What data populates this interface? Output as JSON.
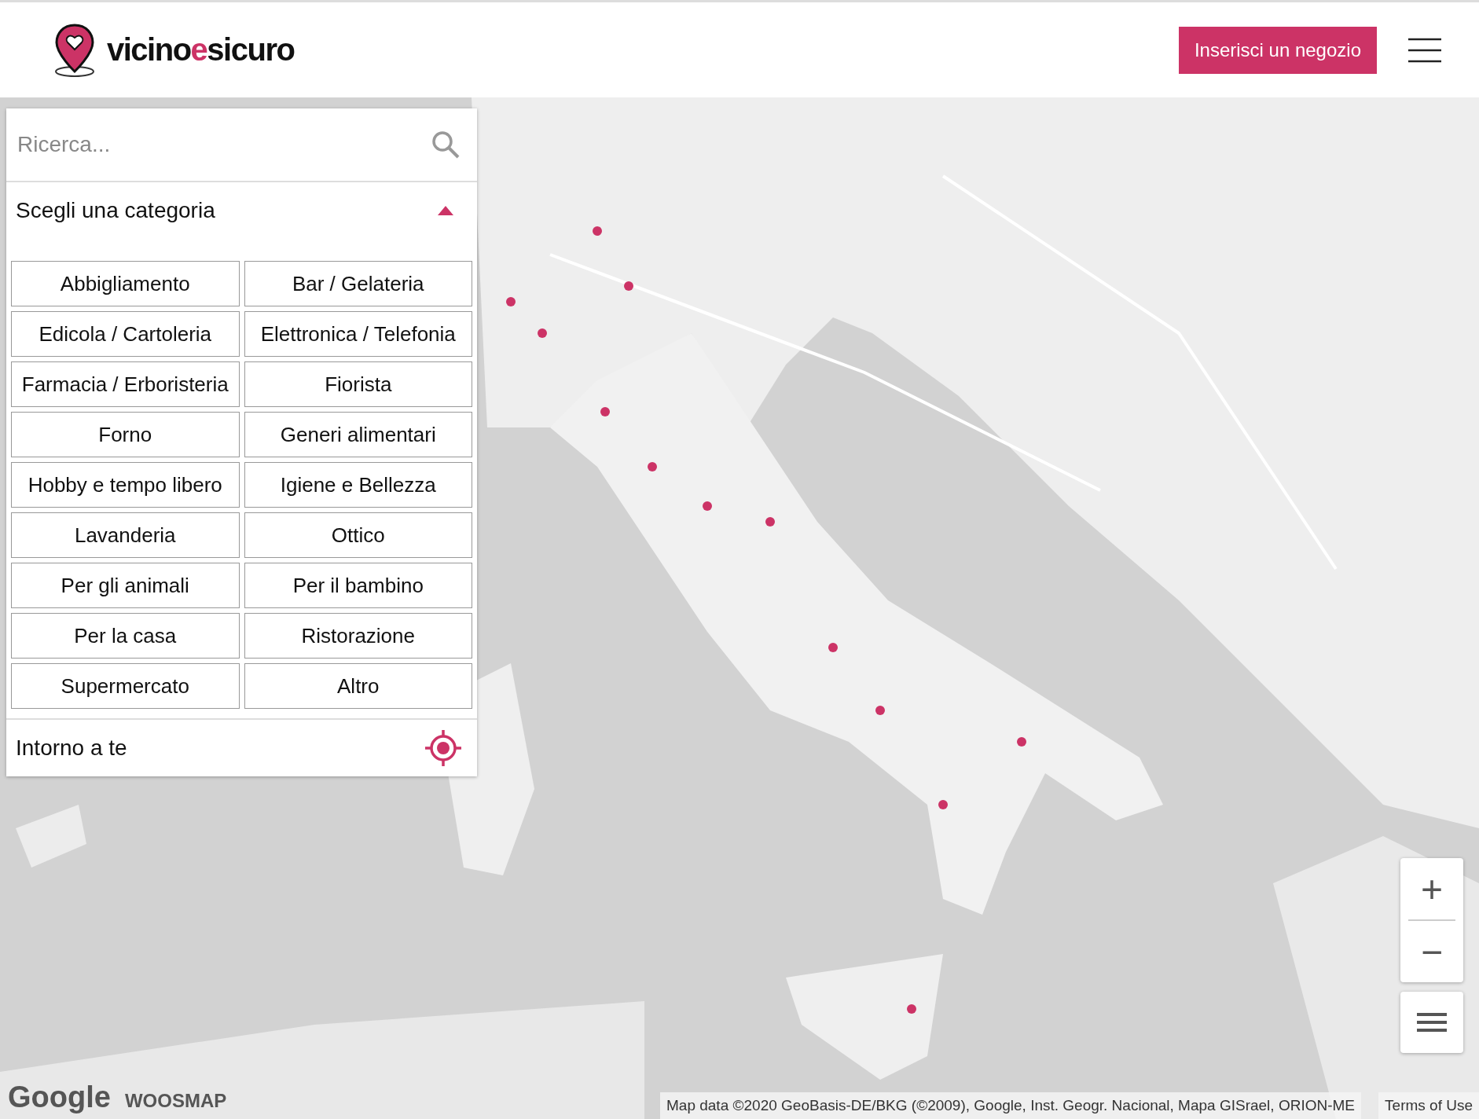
{
  "header": {
    "logo": [
      {
        "text": "vicino",
        "accent": false
      },
      {
        "text": "e",
        "accent": true
      },
      {
        "text": "sicuro",
        "accent": false
      }
    ],
    "cta_button": "Inserisci un negozio"
  },
  "map": {
    "logos": [
      "Google",
      "WOOSMAP"
    ],
    "attribution": "Map data ©2020 GeoBasis-DE/BKG (©2009), Google, Inst. Geogr. Nacional, Mapa GISrael, ORION-ME",
    "terms_link": "Terms of Use",
    "zoom_in": "+",
    "zoom_out": "−"
  },
  "panel": {
    "search": {
      "placeholder": "Ricerca..."
    },
    "category": {
      "label": "Scegli una categoria",
      "expanded": true
    },
    "categories": [
      "Abbigliamento",
      "Bar / Gelateria",
      "Edicola / Cartoleria",
      "Elettronica / Telefonia",
      "Farmacia / Erboristeria",
      "Fiorista",
      "Forno",
      "Generi alimentari",
      "Hobby e tempo libero",
      "Igiene e Bellezza",
      "Lavanderia",
      "Ottico",
      "Per gli animali",
      "Per il bambino",
      "Per la casa",
      "Ristorazione",
      "Supermercato",
      "Altro"
    ],
    "nearby": "Intorno a te"
  }
}
